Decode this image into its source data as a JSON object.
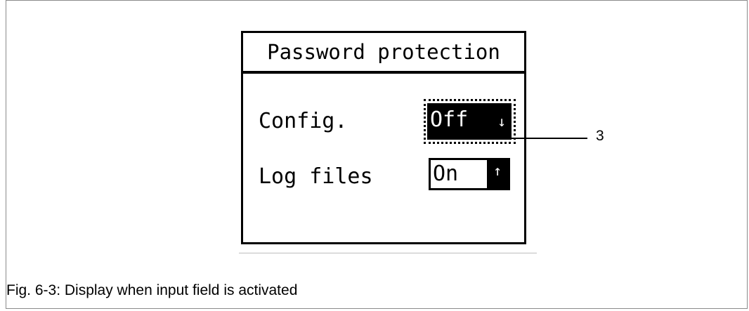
{
  "display": {
    "title": "Password protection",
    "rows": [
      {
        "label": "Config.",
        "value": "Off",
        "arrow": "↓",
        "state": "active-input"
      },
      {
        "label": "Log files",
        "value": "On",
        "arrow": "↑",
        "state": "inactive"
      }
    ]
  },
  "callout": {
    "number": "3"
  },
  "caption": "Fig. 6-3: Display when input field is activated",
  "icons": {
    "config_arrow": "arrow-down-icon",
    "log_arrow": "arrow-up-icon"
  },
  "colors": {
    "foreground": "#000000",
    "background": "#ffffff",
    "frame": "#8a8a8a"
  }
}
